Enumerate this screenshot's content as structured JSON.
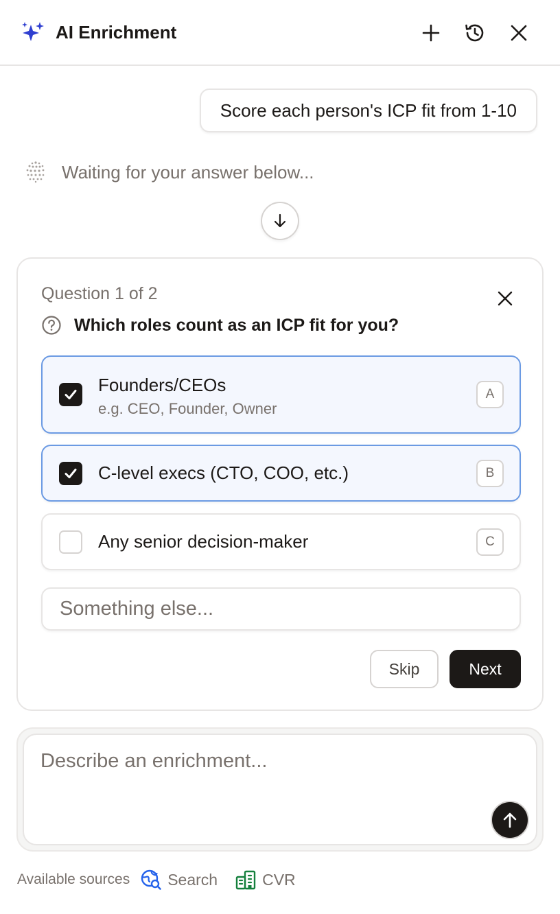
{
  "header": {
    "title": "AI Enrichment",
    "icons": [
      "sparkles-icon",
      "plus-icon",
      "history-icon",
      "close-icon"
    ],
    "accent_color": "#2f3fd0"
  },
  "conversation": {
    "user_message": "Score each person's ICP fit from 1-10",
    "status_text": "Waiting for your answer below..."
  },
  "question": {
    "counter": "Question 1 of 2",
    "title": "Which roles count as an ICP fit for you?",
    "options": [
      {
        "label": "Founders/CEOs",
        "sub": "e.g. CEO, Founder, Owner",
        "key": "A",
        "checked": true
      },
      {
        "label": "C-level execs (CTO, COO, etc.)",
        "key": "B",
        "checked": true
      },
      {
        "label": "Any senior decision-maker",
        "key": "C",
        "checked": false
      }
    ],
    "other_placeholder": "Something else...",
    "skip_label": "Skip",
    "next_label": "Next"
  },
  "composer": {
    "placeholder": "Describe an enrichment..."
  },
  "sources": {
    "label": "Available sources",
    "items": [
      {
        "name": "Search",
        "icon": "globe-search-icon",
        "color": "#2563eb"
      },
      {
        "name": "CVR",
        "icon": "buildings-icon",
        "color": "#15803d"
      }
    ]
  },
  "colors": {
    "selected_border": "#6b9ae3",
    "selected_bg": "#f4f7fe",
    "primary_dark": "#1c1917",
    "muted_text": "#78716c"
  }
}
